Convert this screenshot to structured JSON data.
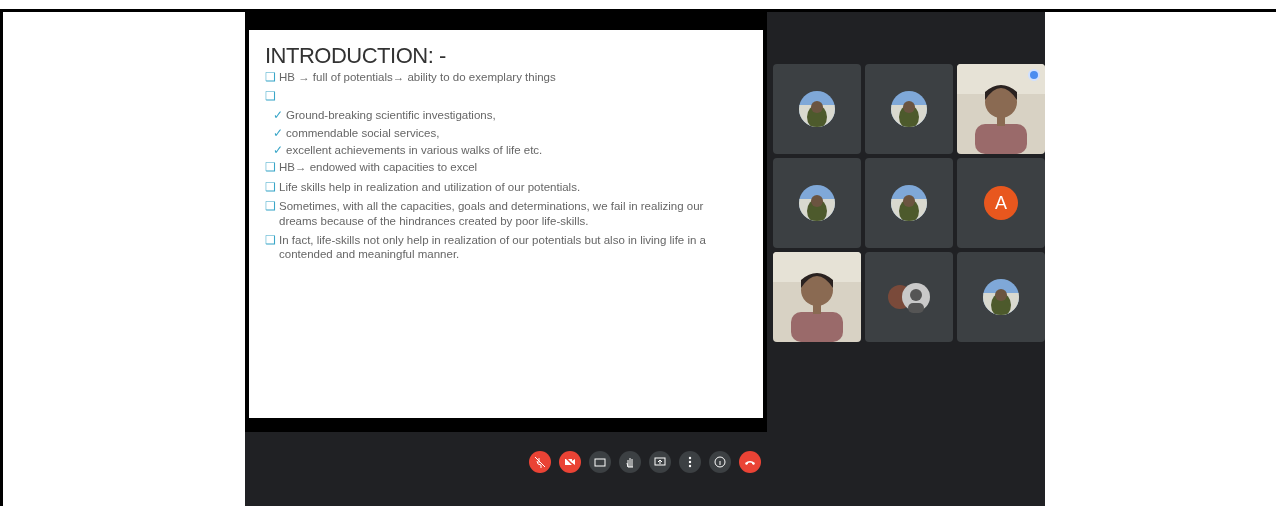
{
  "slide": {
    "title": "INTRODUCTION: -",
    "items": [
      {
        "kind": "bullet",
        "marker": "❑",
        "text": "HB → full of potentials→ ability to do exemplary things"
      },
      {
        "kind": "bullet",
        "marker": "❑"
      },
      {
        "kind": "check",
        "marker": "✓",
        "text": "Ground-breaking scientific investigations,"
      },
      {
        "kind": "check",
        "marker": "✓",
        "text": "commendable social services,"
      },
      {
        "kind": "check",
        "marker": "✓",
        "text": "excellent achievements in various walks of life  etc."
      },
      {
        "kind": "bullet",
        "marker": "❑",
        "text": "HB→ endowed with capacities to excel"
      },
      {
        "kind": "bullet",
        "marker": "❑",
        "text": "Life skills help in realization and utilization of our potentials."
      },
      {
        "kind": "bullet",
        "marker": "❑",
        "text": "Sometimes, with all the capacities, goals and determinations, we fail in realizing our dreams because of the hindrances created by poor life-skills."
      },
      {
        "kind": "bullet",
        "marker": "❑",
        "text": "In fact, life-skills not only help in realization of our potentials but also in living life in a contended and meaningful manner."
      }
    ]
  },
  "participants": [
    {
      "kind": "photo-avatar"
    },
    {
      "kind": "photo-avatar"
    },
    {
      "kind": "video",
      "pinned": true
    },
    {
      "kind": "photo-avatar"
    },
    {
      "kind": "photo-avatar"
    },
    {
      "kind": "letter",
      "letter": "A",
      "color": "#e8571e"
    },
    {
      "kind": "video"
    },
    {
      "kind": "group-avatar"
    },
    {
      "kind": "photo-avatar"
    }
  ],
  "controls": [
    {
      "kind": "mic",
      "danger": true
    },
    {
      "kind": "camera",
      "danger": true
    },
    {
      "kind": "captions",
      "danger": false
    },
    {
      "kind": "hand",
      "danger": false
    },
    {
      "kind": "present",
      "danger": false
    },
    {
      "kind": "more",
      "danger": false
    },
    {
      "kind": "info",
      "danger": false
    },
    {
      "kind": "hangup",
      "danger": true
    }
  ]
}
